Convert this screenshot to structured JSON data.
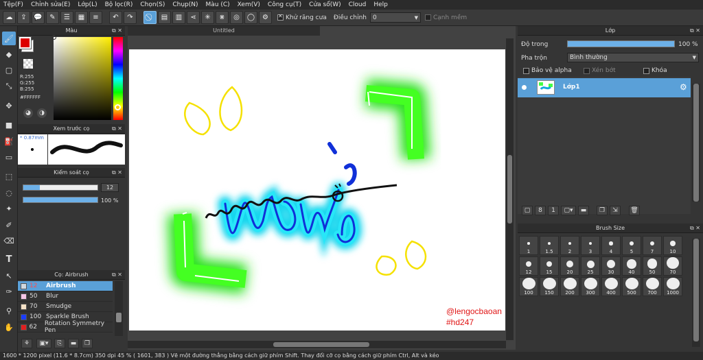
{
  "menu": [
    "Tệp(F)",
    "Chỉnh sửa(E)",
    "Lớp(L)",
    "Bộ lọc(R)",
    "Chọn(S)",
    "Chụp(N)",
    "Màu (C)",
    "Xem(V)",
    "Công cụ(T)",
    "Cửa sổ(W)",
    "Cloud",
    "Help"
  ],
  "toolbar": {
    "antialias_label": "Khử răng cưa",
    "adjust_label": "Điều chỉnh",
    "adjust_value": "0",
    "edge_label": "Cạnh mềm"
  },
  "color_panel": {
    "title": "Màu",
    "r": "R:255",
    "g": "G:255",
    "b": "B:255",
    "hex": "#FFFFFF"
  },
  "brush_preview": {
    "title": "Xem trước cọ",
    "size": "0.87mm"
  },
  "brush_control": {
    "title": "Kiểm soát cọ",
    "size_value": "12",
    "size_fraction": 0.22,
    "opacity_value": "100 %",
    "opacity_fraction": 1.0
  },
  "brush_list": {
    "title": "Cọ: Airbrush",
    "items": [
      {
        "size": "12",
        "name": "Airbrush",
        "color": "#cfd8e0",
        "selected": true
      },
      {
        "size": "50",
        "name": "Blur",
        "color": "#f6c6e6",
        "selected": false
      },
      {
        "size": "70",
        "name": "Smudge",
        "color": "#f3e0c6",
        "selected": false
      },
      {
        "size": "100",
        "name": "Sparkle Brush",
        "color": "#1a3cff",
        "selected": false
      },
      {
        "size": "62",
        "name": "Rotation Symmetry Pen",
        "color": "#e02020",
        "selected": false
      }
    ]
  },
  "document": {
    "tab_title": "Untitled",
    "watermark_line1": "@lengocbaoan",
    "watermark_line2": "#hd247"
  },
  "layer_panel": {
    "title": "Lớp",
    "opacity_label": "Độ trong",
    "opacity_value": "100 %",
    "opacity_fraction": 1.0,
    "blend_label": "Pha trộn",
    "blend_value": "Bình thường",
    "protect_alpha": "Bảo vệ alpha",
    "clipping": "Xén bớt",
    "lock": "Khóa",
    "layer_name": "Lớp1"
  },
  "brush_size_panel": {
    "title": "Brush Size",
    "sizes": [
      "1",
      "1.5",
      "2",
      "3",
      "4",
      "5",
      "7",
      "10",
      "12",
      "15",
      "20",
      "25",
      "30",
      "40",
      "50",
      "70",
      "100",
      "150",
      "200",
      "300",
      "400",
      "500",
      "700",
      "1000"
    ]
  },
  "status": "1600 * 1200 pixel  (11.6 * 8.7cm)  350 dpi  45 %  ( 1601, 383 )  Vẽ một đường thẳng bằng cách giữ phím Shift. Thay đổi cỡ cọ bằng cách giữ phím Ctrl, Alt và kéo"
}
